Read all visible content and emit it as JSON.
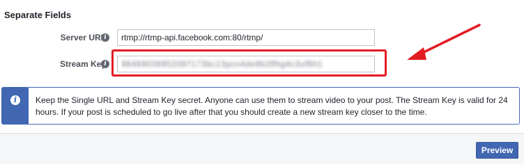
{
  "section": {
    "title": "Separate Fields"
  },
  "fields": {
    "server_url": {
      "label": "Server URL",
      "value": "rtmp://rtmp-api.facebook.com:80/rtmp/"
    },
    "stream_key": {
      "label": "Stream Key",
      "value": "98469036952097173bc13pcn4de9b2ffhg4c3uf6h1"
    }
  },
  "notice": {
    "text": "Keep the Single URL and Stream Key secret. Anyone can use them to stream video to your post. The Stream Key is valid for 24 hours. If your post is scheduled to go live after that you should create a new stream key closer to the time."
  },
  "footer": {
    "preview_label": "Preview"
  },
  "icons": {
    "field_info": "info-icon",
    "notice_info": "info-icon",
    "annotation": "arrow-icon"
  },
  "colors": {
    "brand": "#4267b2",
    "annotation": "#e31b23",
    "footer_bg": "#f5f6f7"
  }
}
